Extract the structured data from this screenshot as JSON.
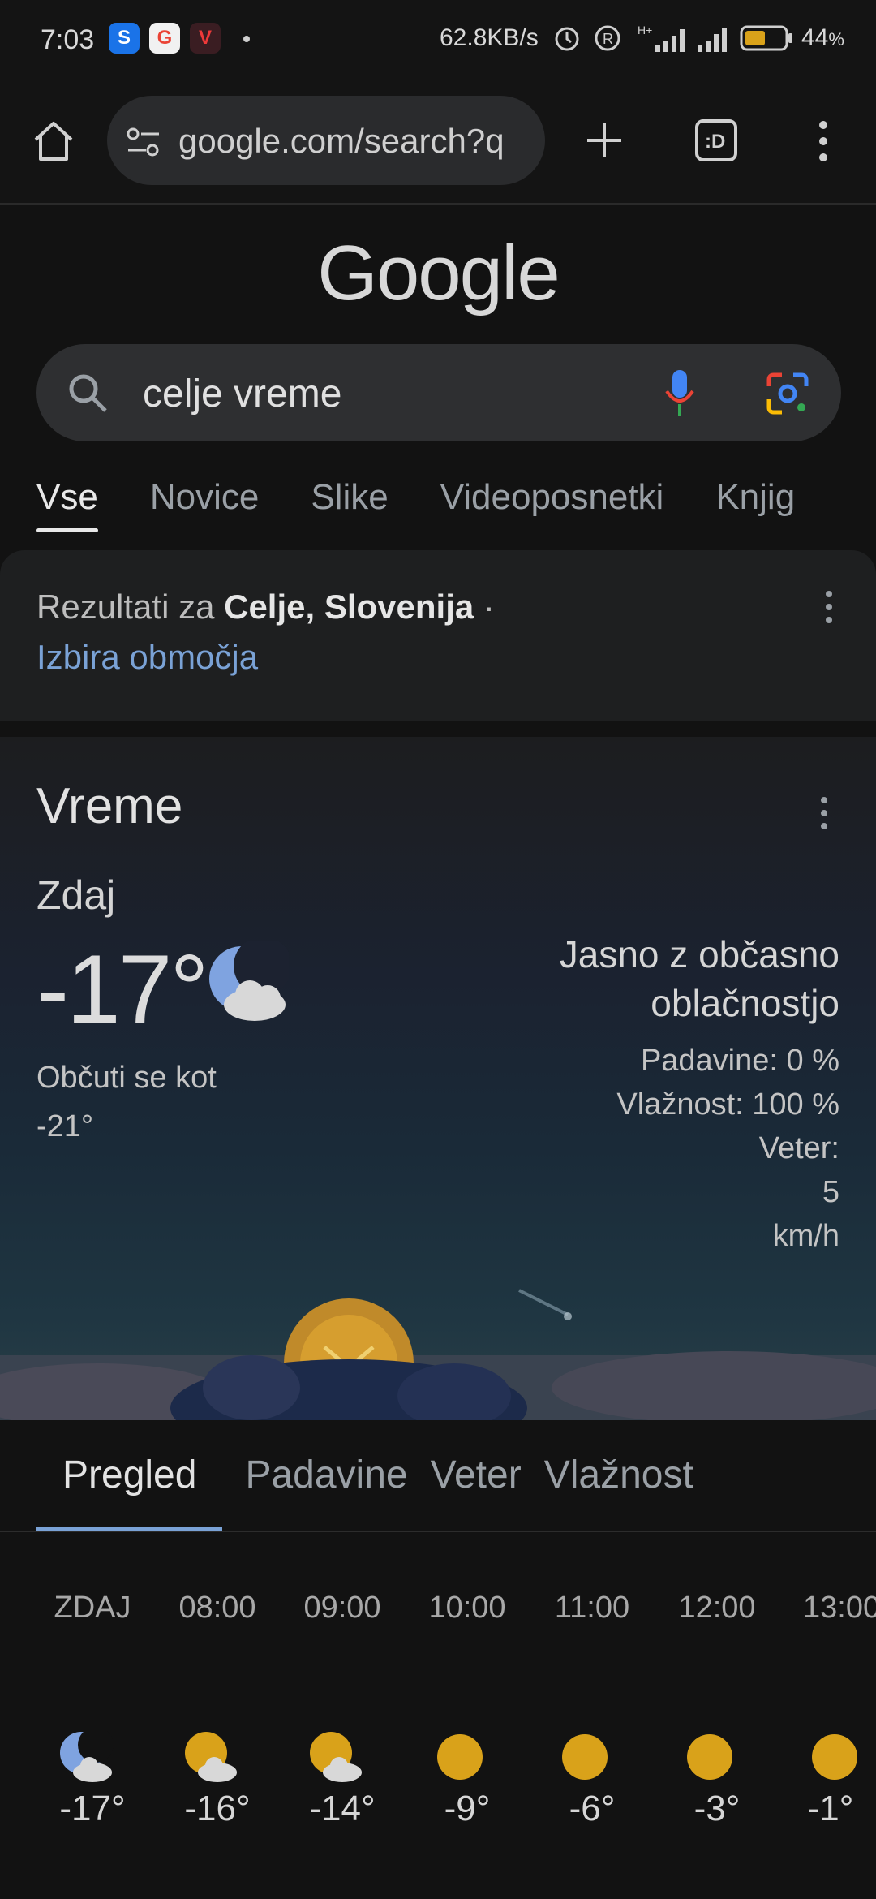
{
  "status_bar": {
    "time": "7:03",
    "net_speed": "62.8KB/s",
    "battery": "44",
    "battery_unit": "%",
    "apps": [
      "shazam-icon",
      "google-icon",
      "vivaldi-icon"
    ]
  },
  "browser": {
    "url": "google.com/search?q"
  },
  "google": {
    "logo_text": "Google",
    "query": "celje vreme",
    "tabs": [
      "Vse",
      "Novice",
      "Slike",
      "Videoposnetki",
      "Knjig"
    ]
  },
  "location": {
    "prefix": "Rezultati za ",
    "place": "Celje, Slovenija",
    "sep": " ·",
    "link": "Izbira območja"
  },
  "weather": {
    "title": "Vreme",
    "now_label": "Zdaj",
    "temp": "-17°",
    "feels_label": "Občuti se kot",
    "feels_value": "-21°",
    "condition_line1": "Jasno z občasno",
    "condition_line2": "oblačnostjo",
    "precip": "Padavine: 0 %",
    "humidity": "Vlažnost: 100 %",
    "wind_label": "Veter:",
    "wind_value": "5",
    "wind_unit": "km/h",
    "tabs": [
      "Pregled",
      "Padavine",
      "Veter",
      "Vlažnost"
    ],
    "hourly": [
      {
        "time": "ZDAJ",
        "temp": "-17°",
        "icon": "moon-cloud"
      },
      {
        "time": "08:00",
        "temp": "-16°",
        "icon": "sun-cloud"
      },
      {
        "time": "09:00",
        "temp": "-14°",
        "icon": "sun-cloud"
      },
      {
        "time": "10:00",
        "temp": "-9°",
        "icon": "sun"
      },
      {
        "time": "11:00",
        "temp": "-6°",
        "icon": "sun"
      },
      {
        "time": "12:00",
        "temp": "-3°",
        "icon": "sun"
      },
      {
        "time": "13:00",
        "temp": "-1°",
        "icon": "sun"
      }
    ]
  },
  "colors": {
    "link": "#7aa2d6",
    "sun": "#d9a21a",
    "moon": "#7fa3e0"
  }
}
